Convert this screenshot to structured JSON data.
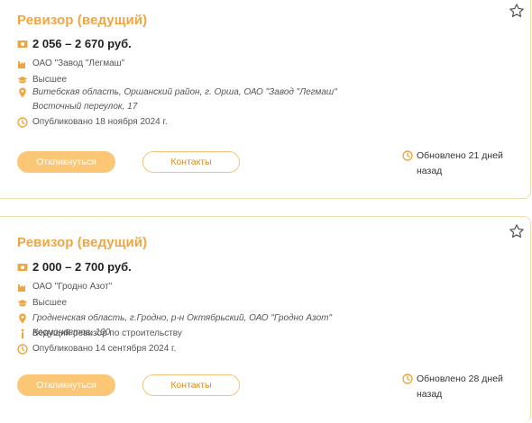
{
  "colors": {
    "accent": "#f0a640",
    "button_fill": "#fbc776",
    "border": "#f0dcae"
  },
  "vacancies": [
    {
      "title": "Ревизор (ведущий)",
      "salary": "2 056 – 2 670 руб.",
      "company": "ОАО \"Завод \"Легмаш\"",
      "education": "Высшее",
      "address": "Витебская область, Оршанский район, г. Орша, ОАО \"Завод \"Легмаш\" Восточный переулок, 17",
      "published": "Опубликовано 18 ноября 2024 г.",
      "respond_label": "Откликнуться",
      "contacts_label": "Контакты",
      "updated": "Обновлено 21 дней назад"
    },
    {
      "title": "Ревизор (ведущий)",
      "salary": "2 000 – 2 700 руб.",
      "company": "ОАО \"Гродно Азот\"",
      "education": "Высшее",
      "address": "Гродненская область, г.Гродно, р-н Октябрьский, ОАО \"Гродно Азот\" Космонавтов, 100",
      "info": "Ведущий ревизор по строительству",
      "published": "Опубликовано 14 сентября 2024 г.",
      "respond_label": "Откликнуться",
      "contacts_label": "Контакты",
      "updated": "Обновлено 28 дней назад"
    }
  ]
}
